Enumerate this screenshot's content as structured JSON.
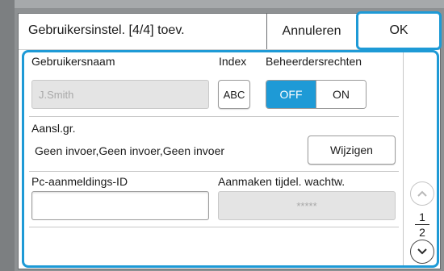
{
  "header": {
    "title": "Gebruikersinstel. [4/4] toev.",
    "cancel_label": "Annuleren",
    "ok_label": "OK"
  },
  "user": {
    "name_label": "Gebruikersnaam",
    "name_value": "J.Smith",
    "index_label": "Index",
    "index_value": "ABC",
    "admin_label": "Beheerdersrechten",
    "admin_off": "OFF",
    "admin_on": "ON",
    "admin_selected": "OFF"
  },
  "group": {
    "label": "Aansl.gr.",
    "value": "Geen invoer,Geen invoer,Geen invoer",
    "change_label": "Wijzigen"
  },
  "pc": {
    "id_label": "Pc-aanmeldings-ID",
    "id_value": "",
    "temp_pw_label": "Aanmaken tijdel. wachtw.",
    "temp_pw_value": "*****"
  },
  "pager": {
    "current": "1",
    "total": "2"
  },
  "colors": {
    "accent": "#1e9ad6"
  }
}
